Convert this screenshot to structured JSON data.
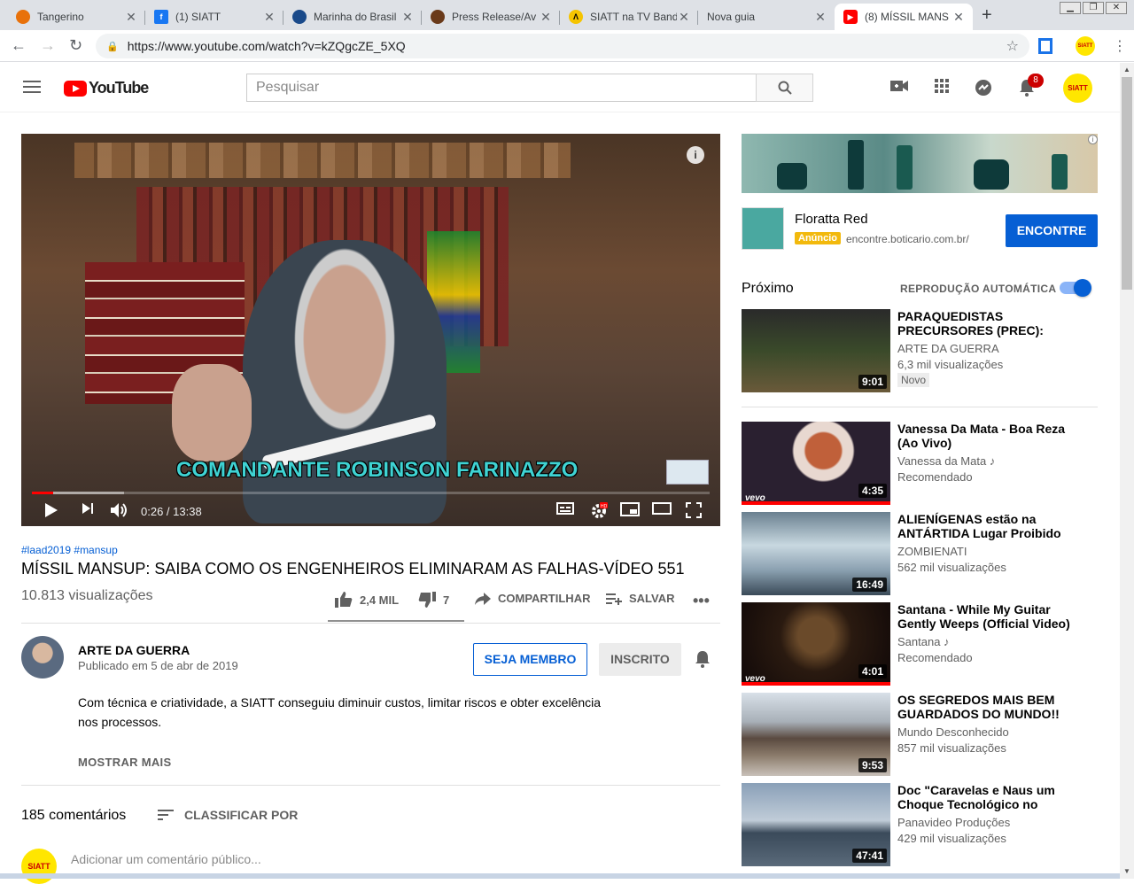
{
  "browser": {
    "tabs": [
      {
        "label": "Tangerino",
        "color": "#e8710a"
      },
      {
        "label": "(1) SIATT",
        "color": "#1877f2"
      },
      {
        "label": "Marinha do Brasil",
        "color": "#1a4a8a"
      },
      {
        "label": "Press Release/Av",
        "color": "#6a3a1a"
      },
      {
        "label": "SIATT na TV Band",
        "color": "#f5c400"
      },
      {
        "label": "Nova guia",
        "color": ""
      },
      {
        "label": "(8) MÍSSIL MANS",
        "color": "#ff0000"
      }
    ],
    "url": "https://www.youtube.com/watch?v=kZQgcZE_5XQ"
  },
  "header": {
    "brand": "YouTube",
    "search_placeholder": "Pesquisar",
    "notification_count": "8",
    "avatar_text": "SIATT"
  },
  "video": {
    "caption": "COMANDANTE ROBINSON FARINAZZO",
    "time": "0:26 / 13:38",
    "progress_played": 0.032,
    "progress_buffered": 0.136
  },
  "meta": {
    "tags": "#laad2019 #mansup",
    "title": "MÍSSIL MANSUP: SAIBA COMO OS ENGENHEIROS ELIMINARAM AS FALHAS-VÍDEO 551",
    "views": "10.813 visualizações",
    "likes": "2,4 MIL",
    "dislikes": "7",
    "share_label": "COMPARTILHAR",
    "save_label": "SALVAR"
  },
  "channel": {
    "name": "ARTE DA GUERRA",
    "published": "Publicado em 5 de abr de 2019",
    "member_label": "SEJA MEMBRO",
    "subscribe_label": "INSCRITO",
    "description": "Com técnica e criatividade, a SIATT conseguiu diminuir custos, limitar riscos e obter excelência nos processos.",
    "show_more": "MOSTRAR MAIS"
  },
  "comments": {
    "count": "185 comentários",
    "sort_label": "CLASSIFICAR POR",
    "avatar_text": "SIATT",
    "placeholder": "Adicionar um comentário público..."
  },
  "ad": {
    "title": "Floratta Red",
    "badge": "Anúncio",
    "url": "encontre.boticario.com.br/",
    "cta": "ENCONTRE"
  },
  "sidebar": {
    "next_label": "Próximo",
    "autoplay_label": "REPRODUÇÃO AUTOMÁTICA",
    "recommendations": [
      {
        "title": "PARAQUEDISTAS PRECURSORES (PREC): QUEM…",
        "channel": "ARTE DA GUERRA",
        "views": "6,3 mil visualizações",
        "badge": "Novo",
        "duration": "9:01"
      },
      {
        "title": "Vanessa Da Mata - Boa Reza (Ao Vivo)",
        "channel": "Vanessa da Mata ♪",
        "views": "Recomendado",
        "badge": "",
        "duration": "4:35"
      },
      {
        "title": "ALIENÍGENAS estão na ANTÁRTIDA Lugar Proibido po…",
        "channel": "ZOMBIENATI",
        "views": "562 mil visualizações",
        "badge": "",
        "duration": "16:49"
      },
      {
        "title": "Santana - While My Guitar Gently Weeps (Official Video)",
        "channel": "Santana ♪",
        "views": "Recomendado",
        "badge": "",
        "duration": "4:01"
      },
      {
        "title": "OS SEGREDOS MAIS BEM GUARDADOS DO MUNDO!!",
        "channel": "Mundo Desconhecido",
        "views": "857 mil visualizações",
        "badge": "",
        "duration": "9:53"
      },
      {
        "title": "Doc \"Caravelas e Naus um Choque Tecnológico no sécul…",
        "channel": "Panavideo Produções",
        "views": "429 mil visualizações",
        "badge": "",
        "duration": "47:41"
      }
    ]
  }
}
